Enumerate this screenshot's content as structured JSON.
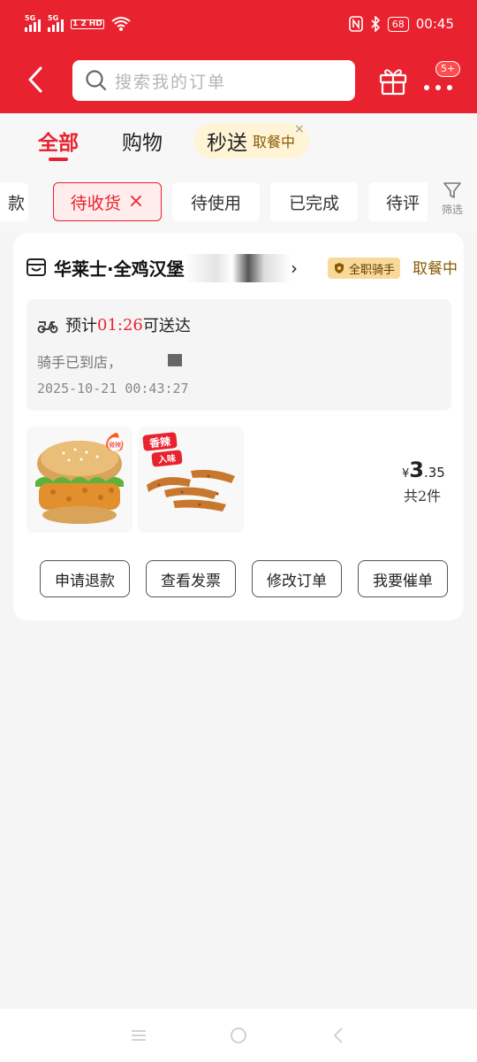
{
  "status_bar": {
    "signal1_label": "5G",
    "signal2_label": "5G",
    "hd_label": "1 2\nHD",
    "battery": "68",
    "time": "00:45"
  },
  "toolbar": {
    "search_placeholder": "搜索我的订单",
    "badge": "5+"
  },
  "tabs": {
    "items": [
      "全部",
      "购物",
      "秒送"
    ],
    "pill_status": "取餐中",
    "close_label": "×"
  },
  "filters": {
    "items": [
      "款",
      "待收货",
      "待使用",
      "已完成",
      "待评"
    ],
    "active_close": "×",
    "filter_label": "筛选"
  },
  "order": {
    "store_name": "华莱士·全鸡汉堡",
    "rider_tag": "全职骑手",
    "status": "取餐中",
    "eta_prefix": "预计",
    "eta_time": "01:26",
    "eta_suffix": "可送达",
    "info": "骑手已到店，",
    "timestamp": "2025-10-21 00:43:27",
    "item1_tag": "微辣",
    "item2_tag1": "香辣",
    "item2_tag2": "入味",
    "price_currency": "¥",
    "price_int": "3",
    "price_dec": ".35",
    "count": "共2件"
  },
  "actions": [
    "申请退款",
    "查看发票",
    "修改订单",
    "我要催单"
  ],
  "colors": {
    "brand_red": "#e8232f",
    "pill_bg": "#fff4d6",
    "rider_tag_bg": "#f8d99a"
  }
}
